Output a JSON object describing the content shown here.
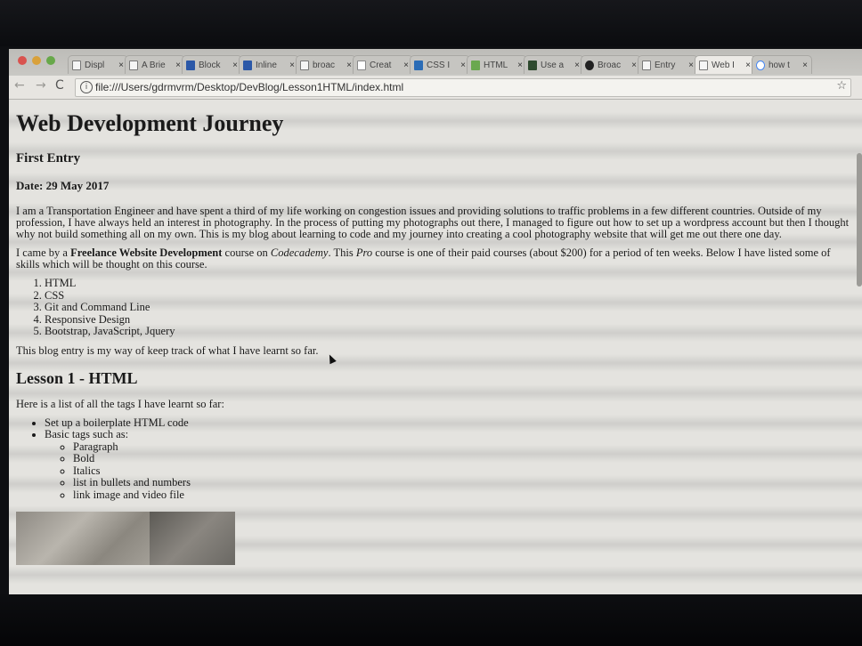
{
  "browser": {
    "tabs": [
      {
        "label": "Displ",
        "icon": "document-icon",
        "active": false
      },
      {
        "label": "A Brie",
        "icon": "document-icon",
        "active": false
      },
      {
        "label": "Block",
        "icon": "video-icon",
        "active": false
      },
      {
        "label": "Inline",
        "icon": "video-icon",
        "active": false
      },
      {
        "label": "broac",
        "icon": "document-icon",
        "active": false
      },
      {
        "label": "Creat",
        "icon": "codecademy-icon",
        "active": false
      },
      {
        "label": "CSS I",
        "icon": "css-icon",
        "active": false
      },
      {
        "label": "HTML",
        "icon": "m-icon",
        "active": false
      },
      {
        "label": "Use a",
        "icon": "terminal-icon",
        "active": false
      },
      {
        "label": "Broac",
        "icon": "github-icon",
        "active": false
      },
      {
        "label": "Entry",
        "icon": "document-icon",
        "active": false
      },
      {
        "label": "Web I",
        "icon": "document-icon",
        "active": true
      },
      {
        "label": "how t",
        "icon": "google-icon",
        "active": false
      }
    ],
    "tab_close": "×",
    "url": "file:///Users/gdrmvrm/Desktop/DevBlog/Lesson1HTML/index.html",
    "back_glyph": "←",
    "forward_glyph": "→",
    "reload_glyph": "C",
    "info_glyph": "i",
    "star_glyph": "☆"
  },
  "page": {
    "title": "Web Development Journey",
    "entry": "First Entry",
    "date": "Date: 29 May 2017",
    "intro": "I am a Transportation Engineer and have spent a third of my life working on congestion issues and providing solutions to traffic problems in a few different countries. Outside of my profession, I have always held an interest in photography. In the process of putting my photographs out there, I managed to figure out how to set up a wordpress account but then I thought why not build something all on my own. This is my blog about learning to code and my journey into creating a cool photography website that will get me out there one day.",
    "course": {
      "before": "I came by a ",
      "bold": "Freelance Website Development",
      "middle1": " course on ",
      "italic1": "Codecademy",
      "middle2": ". This ",
      "italic2": "Pro",
      "after": " course is one of their paid courses (about $200) for a period of ten weeks. Below I have listed some of skills which will be thought on this course."
    },
    "skills": [
      "HTML",
      "CSS",
      "Git and Command Line",
      "Responsive Design",
      "Bootstrap, JavaScript, Jquery"
    ],
    "keep_track": "This blog entry is my way of keep track of what I have learnt so far.",
    "lesson_title": "Lesson 1 - HTML",
    "tags_intro": "Here is a list of all the tags I have learnt so far:",
    "tags": {
      "boilerplate": "Set up a boilerplate HTML code",
      "basic": "Basic tags such as:",
      "basic_items": [
        "Paragraph",
        "Bold",
        "Italics",
        "list in bullets and numbers",
        "link image and video file"
      ]
    }
  }
}
